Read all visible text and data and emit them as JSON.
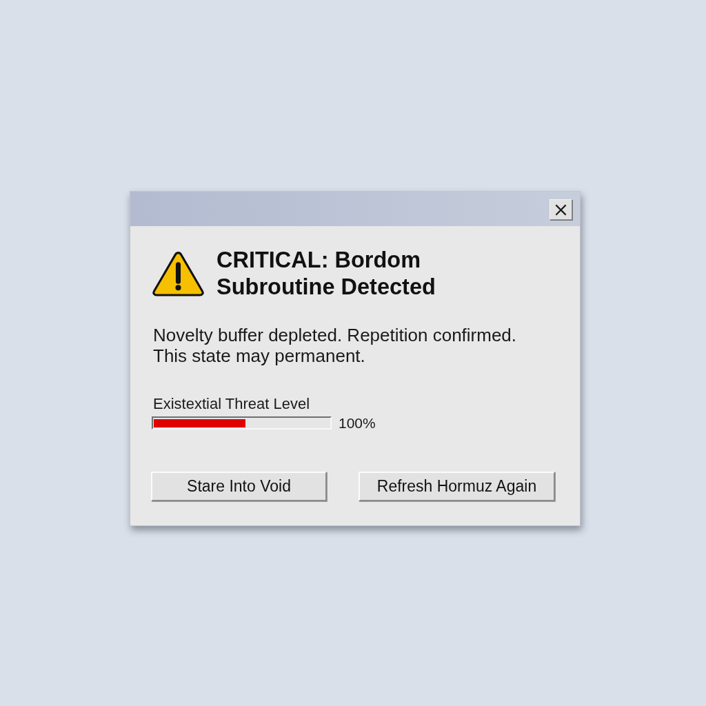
{
  "dialog": {
    "heading": "CRITICAL: Bordom Subroutine Detected",
    "message": "Novelty buffer depleted. Repetition confirmed. This state may permanent.",
    "progress": {
      "label": "Existextial Threat Level",
      "level": 0.52,
      "reading": "100%"
    },
    "buttons": [
      {
        "label": "Stare Into Void"
      },
      {
        "label": "Refresh Hormuz Again"
      }
    ]
  }
}
